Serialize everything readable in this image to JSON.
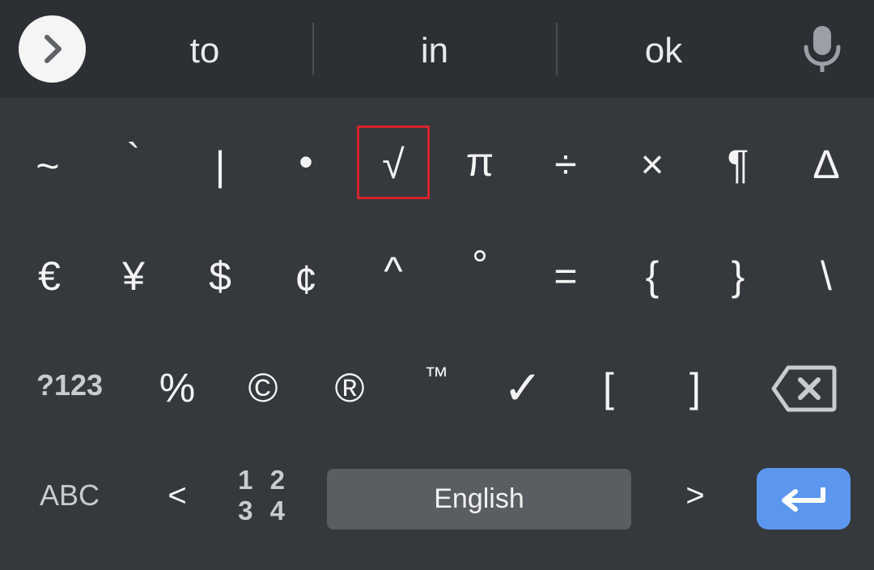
{
  "suggestions": [
    "to",
    "in",
    "ok"
  ],
  "icons": {
    "expand": "chevron-right-icon",
    "mic": "microphone-icon",
    "backspace": "backspace-icon",
    "enter": "enter-arrow-icon"
  },
  "rows": {
    "row1": [
      "~",
      "`",
      "|",
      "•",
      "√",
      "π",
      "÷",
      "×",
      "¶",
      "∆"
    ],
    "row2": [
      "€",
      "¥",
      "$",
      "¢",
      "^",
      "°",
      "=",
      "{",
      "}",
      "\\"
    ],
    "row3": [
      "?123",
      "%",
      "©",
      "®",
      "™",
      "✓",
      "[",
      "]"
    ],
    "row4": [
      "ABC",
      "<",
      "1 2\n3 4",
      "English",
      ">"
    ]
  },
  "highlighted_key": "√",
  "colors": {
    "keyboard_bg": "#35383c",
    "suggestion_bg": "#2c2f33",
    "highlight_border": "#d4242b",
    "enter_bg": "#5b97ee",
    "space_bg": "#5a5d62"
  }
}
